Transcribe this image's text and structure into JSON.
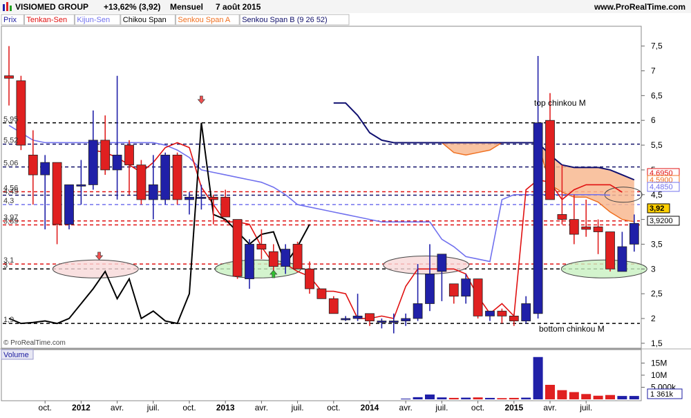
{
  "header": {
    "symbol": "VISIOMED GROUP",
    "change": "+13,62% (3,92)",
    "period": "Mensuel",
    "date": "7 août 2015",
    "site": "www.ProRealTime.com"
  },
  "legend": [
    {
      "label": "Prix",
      "color": "#1a1aa0"
    },
    {
      "label": "Tenkan-Sen",
      "color": "#e01010"
    },
    {
      "label": "Kijun-Sen",
      "color": "#7070ee"
    },
    {
      "label": "Chikou Span",
      "color": "#000000"
    },
    {
      "label": "Senkou Span A",
      "color": "#f07020"
    },
    {
      "label": "Senkou Span B (9 26 52)",
      "color": "#10106a"
    }
  ],
  "colors": {
    "up": "#2020a8",
    "down": "#e02020",
    "tenkan": "#e01010",
    "kijun": "#7070ee",
    "chikou": "#000000",
    "spanA": "#f07020",
    "spanB": "#101070",
    "cloud": "#f8b890"
  },
  "copyright": "© ProRealTime.com",
  "volume_label": "Volume",
  "annotations": {
    "top": "top chinkou M",
    "bottom": "bottom chinkou M"
  },
  "left_levels": [
    {
      "label": "5,95",
      "value": 5.95
    },
    {
      "label": "5,52",
      "value": 5.52
    },
    {
      "label": "5,06",
      "value": 5.06
    },
    {
      "label": "4,56",
      "value": 4.56
    },
    {
      "label": "4,49",
      "value": 4.49
    },
    {
      "label": "4,3",
      "value": 4.3
    },
    {
      "label": "3,97",
      "value": 3.97
    },
    {
      "label": "3,89",
      "value": 3.89
    },
    {
      "label": "3,1",
      "value": 3.1
    },
    {
      "label": "3",
      "value": 3.0
    },
    {
      "label": "1,9",
      "value": 1.9
    }
  ],
  "right_tags": [
    {
      "label": "4,6950",
      "value": 4.695,
      "color": "#e01010"
    },
    {
      "label": "4,5900",
      "value": 4.59,
      "color": "#f07020"
    },
    {
      "label": "4,4850",
      "value": 4.485,
      "color": "#7070ee"
    },
    {
      "label": "3,92",
      "value": 3.92,
      "color": "#000000"
    },
    {
      "label": "3,9200",
      "value": 3.92,
      "color": "#000000"
    }
  ],
  "volume_axis": {
    "ticks": [
      {
        "label": "15M",
        "value": 15
      },
      {
        "label": "10M",
        "value": 10
      },
      {
        "label": "5 000k",
        "value": 5
      }
    ],
    "last": "1 361k",
    "max": 20
  },
  "chart_data": {
    "type": "candlestick",
    "y_axis": {
      "ticks": [
        "1,5",
        "2",
        "2,5",
        "3",
        "3,5",
        "4",
        "4,5",
        "5",
        "5,5",
        "6",
        "6,5",
        "7",
        "7,5"
      ],
      "range": [
        1.4,
        7.9
      ]
    },
    "x_axis": [
      {
        "label": "oct.",
        "bold": false
      },
      {
        "label": "2012",
        "bold": true
      },
      {
        "label": "avr.",
        "bold": false
      },
      {
        "label": "juil.",
        "bold": false
      },
      {
        "label": "oct.",
        "bold": false
      },
      {
        "label": "2013",
        "bold": true
      },
      {
        "label": "avr.",
        "bold": false
      },
      {
        "label": "juil.",
        "bold": false
      },
      {
        "label": "oct.",
        "bold": false
      },
      {
        "label": "2014",
        "bold": true
      },
      {
        "label": "avr.",
        "bold": false
      },
      {
        "label": "juil.",
        "bold": false
      },
      {
        "label": "oct.",
        "bold": false
      },
      {
        "label": "2015",
        "bold": true
      },
      {
        "label": "avr.",
        "bold": false
      },
      {
        "label": "juil.",
        "bold": false
      }
    ],
    "candles": [
      {
        "o": 6.9,
        "h": 7.5,
        "l": 6.3,
        "c": 6.85
      },
      {
        "o": 6.8,
        "h": 6.9,
        "l": 5.4,
        "c": 5.5
      },
      {
        "o": 5.3,
        "h": 5.8,
        "l": 4.3,
        "c": 4.9
      },
      {
        "o": 4.9,
        "h": 5.3,
        "l": 3.8,
        "c": 5.15
      },
      {
        "o": 5.15,
        "h": 5.15,
        "l": 3.5,
        "c": 3.9
      },
      {
        "o": 3.9,
        "h": 4.7,
        "l": 3.8,
        "c": 4.7
      },
      {
        "o": 4.7,
        "h": 5.2,
        "l": 4.3,
        "c": 4.7
      },
      {
        "o": 4.7,
        "h": 6.2,
        "l": 4.6,
        "c": 5.6
      },
      {
        "o": 5.6,
        "h": 6.1,
        "l": 4.9,
        "c": 5.0
      },
      {
        "o": 5.0,
        "h": 6.9,
        "l": 4.4,
        "c": 5.3
      },
      {
        "o": 5.5,
        "h": 5.6,
        "l": 4.5,
        "c": 5.1
      },
      {
        "o": 5.1,
        "h": 5.2,
        "l": 4.3,
        "c": 4.4
      },
      {
        "o": 4.4,
        "h": 5.3,
        "l": 4.0,
        "c": 4.7
      },
      {
        "o": 4.4,
        "h": 5.35,
        "l": 4.3,
        "c": 5.3
      },
      {
        "o": 5.3,
        "h": 5.35,
        "l": 4.3,
        "c": 4.4
      },
      {
        "o": 4.4,
        "h": 4.55,
        "l": 4.1,
        "c": 4.45
      },
      {
        "o": 4.45,
        "h": 4.7,
        "l": 4.2,
        "c": 4.45
      },
      {
        "o": 4.45,
        "h": 4.5,
        "l": 3.9,
        "c": 4.4
      },
      {
        "o": 4.45,
        "h": 4.6,
        "l": 4.2,
        "c": 4.05
      },
      {
        "o": 4.0,
        "h": 4.0,
        "l": 2.8,
        "c": 2.85
      },
      {
        "o": 2.8,
        "h": 3.6,
        "l": 2.6,
        "c": 3.5
      },
      {
        "o": 3.5,
        "h": 3.8,
        "l": 3.2,
        "c": 3.4
      },
      {
        "o": 3.35,
        "h": 3.5,
        "l": 2.95,
        "c": 3.05
      },
      {
        "o": 3.05,
        "h": 3.5,
        "l": 2.9,
        "c": 3.4
      },
      {
        "o": 3.5,
        "h": 3.55,
        "l": 3.0,
        "c": 3.0
      },
      {
        "o": 3.0,
        "h": 3.15,
        "l": 2.5,
        "c": 2.6
      },
      {
        "o": 2.6,
        "h": 2.6,
        "l": 2.4,
        "c": 2.4
      },
      {
        "o": 2.4,
        "h": 2.45,
        "l": 2.1,
        "c": 2.1
      },
      {
        "o": 2.0,
        "h": 2.05,
        "l": 1.95,
        "c": 2.0
      },
      {
        "o": 2.0,
        "h": 2.5,
        "l": 1.95,
        "c": 2.05
      },
      {
        "o": 2.1,
        "h": 2.1,
        "l": 1.85,
        "c": 1.95
      },
      {
        "o": 1.95,
        "h": 2.0,
        "l": 1.8,
        "c": 1.95
      },
      {
        "o": 1.95,
        "h": 2.1,
        "l": 1.7,
        "c": 1.95
      },
      {
        "o": 1.95,
        "h": 2.1,
        "l": 1.85,
        "c": 2.0
      },
      {
        "o": 2.0,
        "h": 3.1,
        "l": 1.95,
        "c": 2.3
      },
      {
        "o": 2.3,
        "h": 3.5,
        "l": 2.15,
        "c": 2.9
      },
      {
        "o": 2.95,
        "h": 3.25,
        "l": 2.35,
        "c": 3.3
      },
      {
        "o": 2.7,
        "h": 2.7,
        "l": 2.3,
        "c": 2.45
      },
      {
        "o": 2.45,
        "h": 2.9,
        "l": 2.3,
        "c": 2.8
      },
      {
        "o": 2.8,
        "h": 2.8,
        "l": 2.0,
        "c": 2.05
      },
      {
        "o": 2.05,
        "h": 2.15,
        "l": 1.95,
        "c": 2.15
      },
      {
        "o": 2.15,
        "h": 2.2,
        "l": 1.9,
        "c": 2.05
      },
      {
        "o": 2.05,
        "h": 2.1,
        "l": 1.85,
        "c": 1.95
      },
      {
        "o": 1.95,
        "h": 2.45,
        "l": 1.9,
        "c": 2.3
      },
      {
        "o": 2.1,
        "h": 7.3,
        "l": 2.0,
        "c": 5.95
      },
      {
        "o": 6.0,
        "h": 6.55,
        "l": 4.4,
        "c": 4.4
      },
      {
        "o": 4.1,
        "h": 5.1,
        "l": 3.9,
        "c": 4.0
      },
      {
        "o": 4.0,
        "h": 4.5,
        "l": 3.5,
        "c": 3.7
      },
      {
        "o": 3.85,
        "h": 4.4,
        "l": 3.65,
        "c": 3.8
      },
      {
        "o": 3.85,
        "h": 4.0,
        "l": 3.3,
        "c": 3.75
      },
      {
        "o": 3.75,
        "h": 3.75,
        "l": 2.95,
        "c": 3.0
      },
      {
        "o": 2.95,
        "h": 3.75,
        "l": 2.95,
        "c": 3.45
      },
      {
        "o": 3.5,
        "h": 4.1,
        "l": 3.35,
        "c": 3.92
      }
    ],
    "volumes": [
      0,
      0,
      0,
      0,
      0,
      0,
      0,
      0,
      0,
      0,
      0,
      0,
      0,
      0,
      0,
      0,
      0,
      0,
      0,
      0,
      0,
      0,
      0,
      0,
      0,
      0,
      0,
      0,
      0,
      0,
      0,
      0,
      0,
      0.3,
      0.9,
      2.0,
      0.8,
      0.6,
      0.7,
      0.8,
      0.6,
      0.5,
      0.6,
      0.7,
      17.5,
      6.0,
      3.8,
      3.0,
      2.2,
      1.5,
      1.8,
      1.4,
      1.4
    ],
    "tenkan": [
      [
        7,
        5.4
      ],
      [
        8,
        5.35
      ],
      [
        9,
        5.25
      ],
      [
        10,
        5.1
      ],
      [
        11,
        4.95
      ],
      [
        12,
        5.15
      ],
      [
        13,
        5.45
      ],
      [
        14,
        5.55
      ],
      [
        15,
        5.45
      ],
      [
        16,
        4.65
      ],
      [
        17,
        4.3
      ],
      [
        18,
        3.95
      ],
      [
        19,
        3.95
      ],
      [
        20,
        3.9
      ],
      [
        21,
        3.45
      ],
      [
        22,
        3.1
      ],
      [
        23,
        3.1
      ],
      [
        24,
        2.95
      ],
      [
        25,
        2.85
      ],
      [
        26,
        2.55
      ],
      [
        27,
        2.55
      ],
      [
        28,
        2.5
      ],
      [
        29,
        2.0
      ],
      [
        30,
        2.0
      ],
      [
        31,
        2.05
      ],
      [
        32,
        2.0
      ],
      [
        33,
        2.65
      ],
      [
        34,
        3.0
      ],
      [
        35,
        3.0
      ],
      [
        36,
        3.0
      ],
      [
        37,
        3.0
      ],
      [
        38,
        2.9
      ],
      [
        39,
        2.45
      ],
      [
        40,
        2.1
      ],
      [
        41,
        2.3
      ],
      [
        42,
        2.05
      ],
      [
        43,
        4.6
      ],
      [
        44,
        4.8
      ],
      [
        45,
        4.75
      ],
      [
        46,
        4.4
      ],
      [
        47,
        4.6
      ],
      [
        48,
        4.7
      ],
      [
        49,
        4.7
      ],
      [
        50,
        4.7
      ],
      [
        51,
        4.55
      ]
    ],
    "kijun": [
      [
        0,
        5.9
      ],
      [
        1,
        5.75
      ],
      [
        2,
        5.6
      ],
      [
        3,
        5.55
      ],
      [
        4,
        5.55
      ],
      [
        5,
        5.55
      ],
      [
        6,
        5.55
      ],
      [
        7,
        5.55
      ],
      [
        8,
        5.55
      ],
      [
        9,
        5.55
      ],
      [
        10,
        5.55
      ],
      [
        11,
        5.55
      ],
      [
        12,
        5.55
      ],
      [
        13,
        5.5
      ],
      [
        14,
        5.4
      ],
      [
        15,
        5.25
      ],
      [
        16,
        5.0
      ],
      [
        17,
        4.95
      ],
      [
        18,
        4.9
      ],
      [
        19,
        4.85
      ],
      [
        20,
        4.8
      ],
      [
        21,
        4.75
      ],
      [
        22,
        4.65
      ],
      [
        23,
        4.5
      ],
      [
        24,
        4.3
      ],
      [
        25,
        4.25
      ],
      [
        26,
        4.2
      ],
      [
        27,
        4.15
      ],
      [
        28,
        4.1
      ],
      [
        29,
        4.05
      ],
      [
        30,
        4.0
      ],
      [
        31,
        3.95
      ],
      [
        32,
        3.95
      ],
      [
        33,
        3.95
      ],
      [
        34,
        3.95
      ],
      [
        35,
        3.95
      ],
      [
        36,
        3.6
      ],
      [
        37,
        3.45
      ],
      [
        38,
        3.25
      ],
      [
        39,
        3.2
      ],
      [
        40,
        3.15
      ],
      [
        41,
        4.4
      ],
      [
        42,
        4.5
      ],
      [
        43,
        4.5
      ],
      [
        44,
        4.5
      ],
      [
        45,
        4.5
      ],
      [
        46,
        4.5
      ],
      [
        47,
        4.5
      ],
      [
        48,
        4.5
      ],
      [
        49,
        4.5
      ],
      [
        50,
        4.49
      ]
    ],
    "chikou": [
      [
        0,
        2.0
      ],
      [
        1,
        1.9
      ],
      [
        2,
        1.92
      ],
      [
        3,
        1.95
      ],
      [
        4,
        1.9
      ],
      [
        5,
        2.0
      ],
      [
        6,
        2.3
      ],
      [
        7,
        2.6
      ],
      [
        8,
        2.95
      ],
      [
        9,
        2.4
      ],
      [
        10,
        2.8
      ],
      [
        11,
        2.0
      ],
      [
        12,
        2.15
      ],
      [
        13,
        1.95
      ],
      [
        14,
        1.9
      ],
      [
        15,
        2.5
      ],
      [
        16,
        5.95
      ],
      [
        17,
        4.1
      ],
      [
        18,
        4.0
      ],
      [
        19,
        3.75
      ],
      [
        20,
        3.5
      ],
      [
        21,
        3.7
      ],
      [
        22,
        3.75
      ],
      [
        23,
        3.1
      ],
      [
        24,
        3.45
      ],
      [
        25,
        3.9
      ]
    ],
    "spanB": [
      [
        27,
        6.35
      ],
      [
        28,
        6.35
      ],
      [
        29,
        6.1
      ],
      [
        30,
        5.75
      ],
      [
        31,
        5.6
      ],
      [
        32,
        5.55
      ],
      [
        33,
        5.55
      ],
      [
        34,
        5.55
      ],
      [
        35,
        5.55
      ],
      [
        36,
        5.55
      ],
      [
        37,
        5.55
      ],
      [
        38,
        5.55
      ],
      [
        39,
        5.55
      ],
      [
        40,
        5.55
      ],
      [
        41,
        5.55
      ],
      [
        42,
        5.55
      ],
      [
        43,
        5.55
      ],
      [
        44,
        5.55
      ],
      [
        45,
        5.3
      ],
      [
        46,
        5.1
      ],
      [
        47,
        5.05
      ],
      [
        48,
        5.05
      ],
      [
        49,
        5.05
      ],
      [
        50,
        5.0
      ],
      [
        51,
        4.9
      ],
      [
        52,
        4.8
      ]
    ],
    "spanA": [
      [
        36,
        5.55
      ],
      [
        37,
        5.35
      ],
      [
        38,
        5.3
      ],
      [
        39,
        5.35
      ],
      [
        40,
        5.4
      ],
      [
        41,
        5.55
      ],
      [
        42,
        5.55
      ],
      [
        43,
        5.55
      ],
      [
        44,
        5.55
      ],
      [
        45,
        4.7
      ],
      [
        46,
        4.55
      ],
      [
        47,
        4.45
      ],
      [
        48,
        4.45
      ],
      [
        49,
        4.35
      ],
      [
        50,
        4.15
      ],
      [
        51,
        4.0
      ],
      [
        52,
        3.95
      ]
    ],
    "hlines": [
      {
        "value": 5.95,
        "color": "#000000"
      },
      {
        "value": 5.52,
        "color": "#10106a"
      },
      {
        "value": 5.06,
        "color": "#10106a"
      },
      {
        "value": 4.56,
        "color": "#e01010"
      },
      {
        "value": 4.49,
        "color": "#10106a"
      },
      {
        "value": 4.3,
        "color": "#7070ee"
      },
      {
        "value": 3.97,
        "color": "#e01010"
      },
      {
        "value": 3.89,
        "color": "#e01010"
      },
      {
        "value": 3.1,
        "color": "#e01010"
      },
      {
        "value": 3.0,
        "color": "#000000"
      },
      {
        "value": 1.9,
        "color": "#000000"
      }
    ]
  }
}
